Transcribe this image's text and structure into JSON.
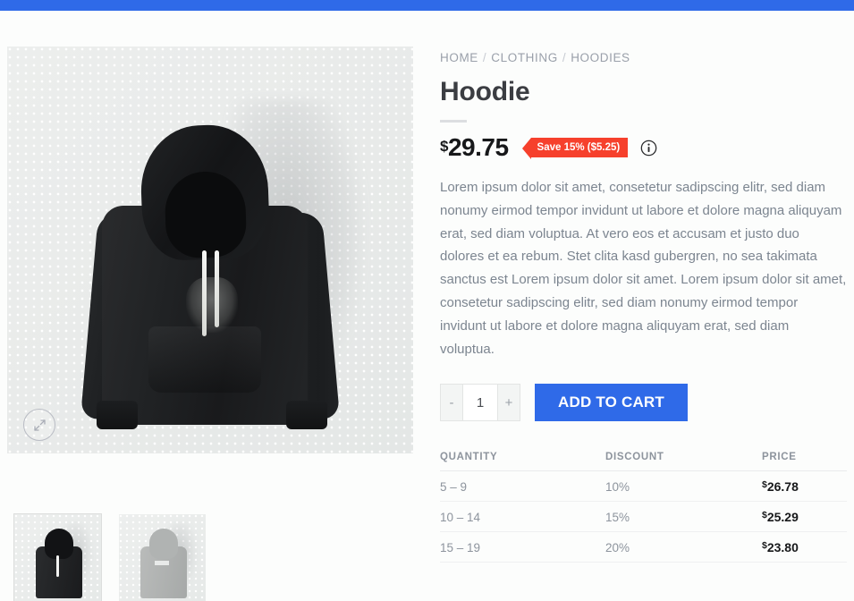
{
  "theme": {
    "accent_blue": "#2f6ae8",
    "badge_red": "#f6402c",
    "title_color": "#3b3d42",
    "muted_text": "#8d949d"
  },
  "breadcrumb": {
    "separator": "/",
    "items": [
      {
        "label": "HOME"
      },
      {
        "label": "CLOTHING"
      },
      {
        "label": "HOODIES"
      }
    ]
  },
  "product": {
    "title": "Hoodie",
    "price": "29.75",
    "currency_symbol": "$",
    "save_badge": "Save 15% ($5.25)",
    "info_icon": "info-circle-icon",
    "description": "Lorem ipsum dolor sit amet, consetetur sadipscing elitr, sed diam nonumy eirmod tempor invidunt ut labore et dolore magna aliquyam erat, sed diam voluptua. At vero eos et accusam et justo duo dolores et ea rebum. Stet clita kasd gubergren, no sea takimata sanctus est Lorem ipsum dolor sit amet. Lorem ipsum dolor sit amet, consetetur sadipscing elitr, sed diam nonumy eirmod tempor invidunt ut labore et dolore magna aliquyam erat, sed diam voluptua."
  },
  "gallery": {
    "expand_icon": "expand-arrows-icon",
    "main_image_alt": "Black hoodie front view",
    "thumbnails": [
      {
        "alt": "Black hoodie thumbnail",
        "active": true
      },
      {
        "alt": "Light gray hoodie thumbnail",
        "active": false
      }
    ]
  },
  "buy": {
    "decrement_label": "-",
    "increment_label": "+",
    "quantity_value": "1",
    "add_to_cart_label": "ADD TO CART"
  },
  "tier_table": {
    "headers": [
      "QUANTITY",
      "DISCOUNT",
      "PRICE"
    ],
    "rows": [
      {
        "quantity": "5 – 9",
        "discount": "10%",
        "currency": "$",
        "price": "26.78"
      },
      {
        "quantity": "10 – 14",
        "discount": "15%",
        "currency": "$",
        "price": "25.29"
      },
      {
        "quantity": "15 – 19",
        "discount": "20%",
        "currency": "$",
        "price": "23.80"
      }
    ]
  }
}
